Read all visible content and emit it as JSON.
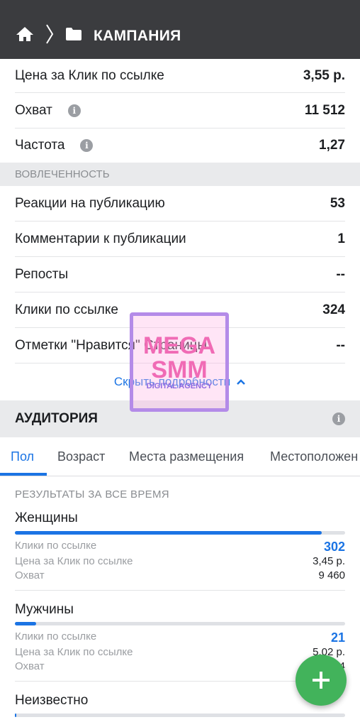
{
  "header": {
    "title": "КАМПАНИЯ"
  },
  "metrics_top": [
    {
      "label": "Цена за Клик по ссылке",
      "value": "3,55 р."
    },
    {
      "label": "Охват",
      "value": "11 512"
    },
    {
      "label": "Частота",
      "value": "1,27"
    }
  ],
  "engagement": {
    "section_label": "ВОВЛЕЧЕННОСТЬ",
    "rows": [
      {
        "label": "Реакции на публикацию",
        "value": "53"
      },
      {
        "label": "Комментарии к публикации",
        "value": "1"
      },
      {
        "label": "Репосты",
        "value": "--"
      },
      {
        "label": "Клики по ссылке",
        "value": "324"
      },
      {
        "label": "Отметки \"Нравится\" Страницы",
        "value": "--"
      }
    ],
    "hide_details": "Скрыть подробности"
  },
  "audience": {
    "title": "АУДИТОРИЯ",
    "tabs": [
      "Пол",
      "Возраст",
      "Места размещения",
      "Местоположен"
    ],
    "active_tab": 0,
    "results_title": "РЕЗУЛЬТАТЫ ЗА ВСЕ ВРЕМЯ",
    "groups": [
      {
        "name": "Женщины",
        "share": 0.93,
        "clicks_label": "Клики по ссылке",
        "clicks": "302",
        "cpc_label": "Цена за Клик по ссылке",
        "cpc": "3,45 р.",
        "reach_label": "Охват",
        "reach": "9 460"
      },
      {
        "name": "Мужчины",
        "share": 0.065,
        "clicks_label": "Клики по ссылке",
        "clicks": "21",
        "cpc_label": "Цена за Клик по ссылке",
        "cpc": "5,02 р.",
        "reach_label": "Охват",
        "reach": "1 9…4"
      },
      {
        "name": "Неизвестно",
        "share": 0.005
      }
    ]
  },
  "watermark": {
    "line1": "MEGA",
    "line2": "SMM",
    "line3": "DIGITAL AGENCY"
  },
  "colors": {
    "accent": "#1b74e4",
    "header_bg": "#3b3c3f",
    "fab": "#42b35b"
  }
}
